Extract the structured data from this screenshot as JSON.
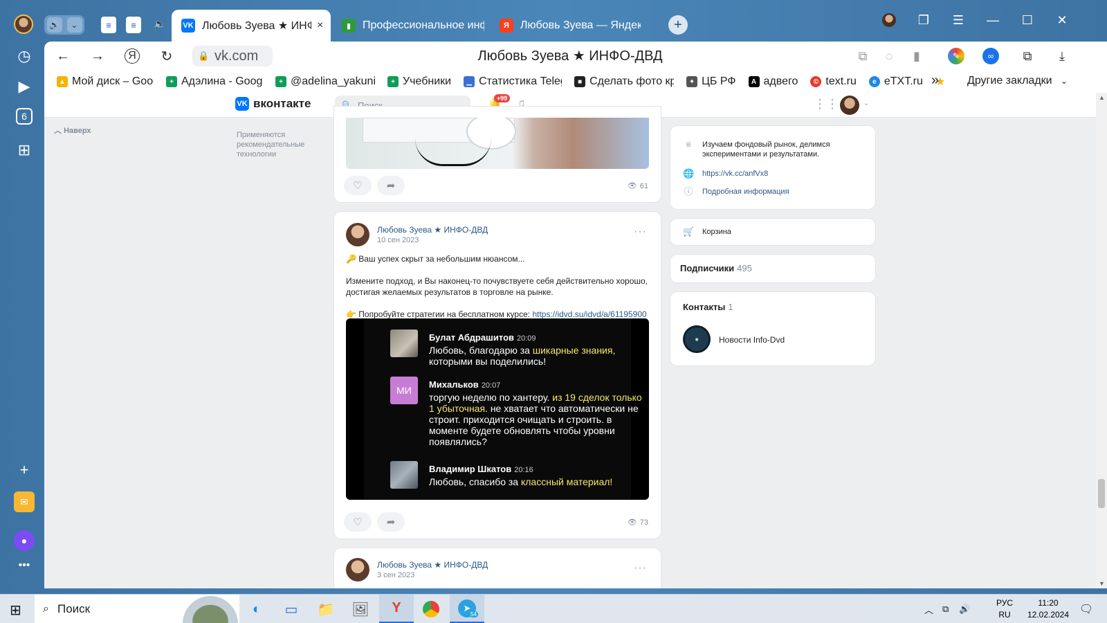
{
  "browser": {
    "tabs": [
      {
        "title": "Любовь Зуева ★ ИНФО-ДВД",
        "favicon": "vk-icon",
        "active": true
      },
      {
        "title": "Профессиональное инфо",
        "favicon": "green-leaf-icon",
        "active": false
      },
      {
        "title": "Любовь Зуева — Яндекс",
        "favicon": "yandex-icon",
        "active": false
      }
    ],
    "url": "vk.com",
    "page_title": "Любовь Зуева ★ ИНФО-ДВД",
    "bookmarks": [
      {
        "label": "Мой диск – Googl",
        "icon": "google-drive-icon",
        "color": "#f4b400"
      },
      {
        "label": "Адэлина - Google",
        "icon": "google-sheets-icon",
        "color": "#0f9d58"
      },
      {
        "label": "@adelina_yakunin",
        "icon": "google-sheets-icon",
        "color": "#0f9d58"
      },
      {
        "label": "Учебники",
        "icon": "google-sheets-icon",
        "color": "#0f9d58"
      },
      {
        "label": "Статистика Telegr",
        "icon": "stats-icon",
        "color": "#3b6fd1"
      },
      {
        "label": "Сделать фото кру",
        "icon": "photo-icon",
        "color": "#222222"
      },
      {
        "label": "ЦБ РФ",
        "icon": "cbr-icon",
        "color": "#555555"
      },
      {
        "label": "адвего",
        "icon": "advego-icon",
        "color": "#000000"
      },
      {
        "label": "text.ru",
        "icon": "textru-icon",
        "color": "#e23b2e"
      },
      {
        "label": "eTXT.ru",
        "icon": "etxt-icon",
        "color": "#1e88e5"
      }
    ],
    "bookmarks_other": "Другие закладки"
  },
  "vk": {
    "logo": "вконтакте",
    "search_placeholder": "Поиск",
    "notifications_badge": "+99",
    "back_to_top": "Наверх",
    "recommendation_note": "Применяются рекомендательные технологии",
    "posts": [
      {
        "views": "61"
      },
      {
        "author": "Любовь Зуева ★ ИНФО-ДВД",
        "date": "10 сен 2023",
        "line1": "🔑 Ваш успех скрыт за небольшим нюансом...",
        "line2": "Измените подход, и Вы наконец-то почувствуете себя действительно хорошо, достигая желаемых результатов в торговле на рынке.",
        "line3_prefix": "👉 Попробуйте стратегии на бесплатном курсе: ",
        "line3_link": "https://idvd.su/idvd/a/61195900",
        "views": "73",
        "chat": [
          {
            "name": "Булат Абдрашитов",
            "time": "20:09",
            "text_a": "Любовь, благодарю за ",
            "text_hl": "шикарные знания,",
            "text_b": " которыми вы поделились!"
          },
          {
            "name": "Михальков",
            "time": "20:07",
            "avatar_text": "МИ",
            "text_a": "торгую неделю по хантеру. ",
            "text_hl": "из 19 сделок только 1 убыточная",
            "text_b": ". не хватает что автоматически не строит. приходится очищать и строить. в моменте будете обновлять чтобы уровни появлялись?"
          },
          {
            "name": "Владимир Шкатов",
            "time": "20:16",
            "text_a": "Любовь, спасибо за ",
            "text_hl": "классный материал!",
            "text_b": ""
          }
        ]
      },
      {
        "author": "Любовь Зуева ★ ИНФО-ДВД",
        "date": "3 сен 2023"
      }
    ],
    "sidebar": {
      "description": "Изучаем фондовый рынок, делимся экспериментами и результатами.",
      "link": "https://vk.cc/anfVx8",
      "more_info": "Подробная информация",
      "cart": "Корзина",
      "subscribers_label": "Подписчики",
      "subscribers_count": "495",
      "contacts_label": "Контакты",
      "contacts_count": "1",
      "contact_name": "Новости Info-Dvd"
    }
  },
  "taskbar": {
    "search": "Поиск",
    "lang_top": "РУС",
    "lang_bottom": "RU",
    "time": "11:20",
    "date": "12.02.2024",
    "telegram_badge": "54"
  }
}
